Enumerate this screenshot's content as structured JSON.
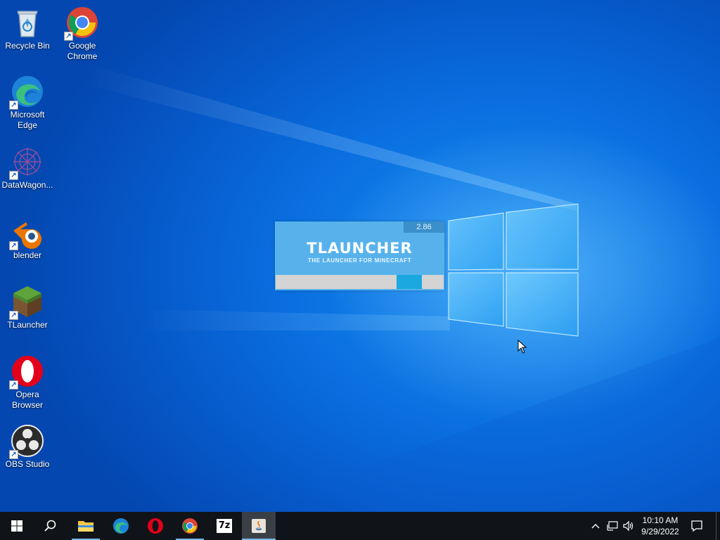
{
  "desktop": {
    "icons": [
      {
        "label": "Recycle Bin",
        "icon": "recycle-bin-icon",
        "shortcut": false
      },
      {
        "label": "Google Chrome",
        "icon": "chrome-icon",
        "shortcut": true
      },
      {
        "label": "Microsoft Edge",
        "icon": "edge-icon",
        "shortcut": true
      },
      {
        "label": "DataWagon...",
        "icon": "datawagon-icon",
        "shortcut": true
      },
      {
        "label": "blender",
        "icon": "blender-icon",
        "shortcut": true
      },
      {
        "label": "TLauncher",
        "icon": "minecraft-grass-block-icon",
        "shortcut": true
      },
      {
        "label": "Opera Browser",
        "icon": "opera-icon",
        "shortcut": true
      },
      {
        "label": "OBS Studio",
        "icon": "obs-icon",
        "shortcut": true
      }
    ]
  },
  "splash": {
    "version": "2.86",
    "title": "TLAUNCHER",
    "subtitle": "THE LAUNCHER FOR MINECRAFT",
    "progress_indicator": {
      "start_fraction": 0.72,
      "width_fraction": 0.15
    }
  },
  "taskbar": {
    "buttons": [
      {
        "name": "start-button",
        "icon": "windows-logo-icon"
      },
      {
        "name": "search-button",
        "icon": "search-icon"
      },
      {
        "name": "file-explorer-button",
        "icon": "folder-icon",
        "running": true
      },
      {
        "name": "edge-taskbar-button",
        "icon": "edge-icon"
      },
      {
        "name": "opera-taskbar-button",
        "icon": "opera-icon"
      },
      {
        "name": "chrome-taskbar-button",
        "icon": "chrome-icon",
        "running": true
      },
      {
        "name": "7zip-taskbar-button",
        "icon": "7zip-icon",
        "label": "7z"
      },
      {
        "name": "java-taskbar-button",
        "icon": "java-icon",
        "focused": true
      }
    ],
    "tray": {
      "time": "10:10 AM",
      "date": "9/29/2022"
    }
  },
  "colors": {
    "desktop_blue": "#0a6fe0",
    "taskbar": "#101418",
    "splash_bg": "#57b2ec",
    "progress_fill": "#1ba8e0"
  }
}
